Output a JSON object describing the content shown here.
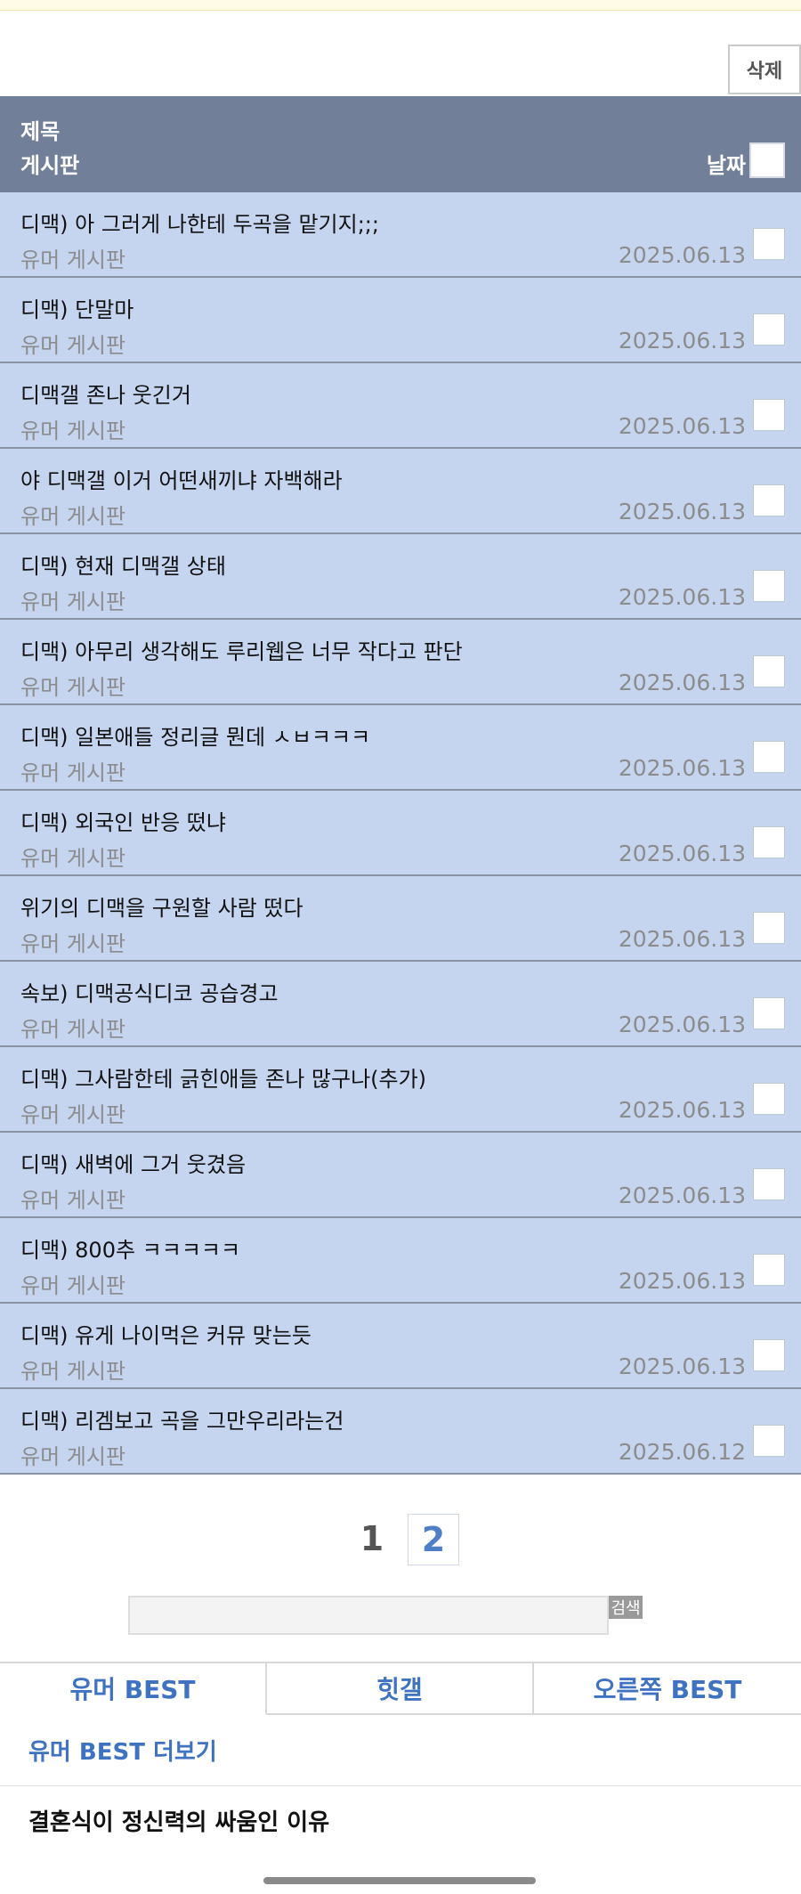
{
  "toolbar": {
    "delete_label": "삭제"
  },
  "table": {
    "header": {
      "title": "제목",
      "board": "게시판",
      "date": "날짜"
    },
    "rows": [
      {
        "title": "디맥) 아 그러게 나한테 두곡을 맡기지;;;",
        "board": "유머 게시판",
        "date": "2025.06.13"
      },
      {
        "title": "디맥) 단말마",
        "board": "유머 게시판",
        "date": "2025.06.13"
      },
      {
        "title": "디맥갤 존나 웃긴거",
        "board": "유머 게시판",
        "date": "2025.06.13"
      },
      {
        "title": "야 디맥갤 이거 어떤새끼냐 자백해라",
        "board": "유머 게시판",
        "date": "2025.06.13"
      },
      {
        "title": "디맥) 현재 디맥갤 상태",
        "board": "유머 게시판",
        "date": "2025.06.13"
      },
      {
        "title": "디맥) 아무리 생각해도 루리웹은 너무 작다고 판단",
        "board": "유머 게시판",
        "date": "2025.06.13"
      },
      {
        "title": "디맥) 일본애들 정리글 뭔데 ㅅㅂㅋㅋㅋ",
        "board": "유머 게시판",
        "date": "2025.06.13"
      },
      {
        "title": "디맥) 외국인 반응 떴냐",
        "board": "유머 게시판",
        "date": "2025.06.13"
      },
      {
        "title": "위기의 디맥을 구원할 사람 떴다",
        "board": "유머 게시판",
        "date": "2025.06.13"
      },
      {
        "title": "속보) 디맥공식디코 공습경고",
        "board": "유머 게시판",
        "date": "2025.06.13"
      },
      {
        "title": "디맥) 그사람한테 긁힌애들 존나 많구나(추가)",
        "board": "유머 게시판",
        "date": "2025.06.13"
      },
      {
        "title": "디맥) 새벽에 그거 웃겼음",
        "board": "유머 게시판",
        "date": "2025.06.13"
      },
      {
        "title": "디맥) 800추 ㅋㅋㅋㅋㅋ",
        "board": "유머 게시판",
        "date": "2025.06.13"
      },
      {
        "title": "디맥) 유게 나이먹은 커뮤 맞는듯",
        "board": "유머 게시판",
        "date": "2025.06.13"
      },
      {
        "title": "디맥) 리겜보고 곡을 그만우리라는건",
        "board": "유머 게시판",
        "date": "2025.06.12"
      }
    ]
  },
  "pagination": {
    "current": "1",
    "next": "2"
  },
  "search": {
    "placeholder": "",
    "button_label": "검색"
  },
  "best_tabs": [
    "유머 BEST",
    "힛갤",
    "오른쪽 BEST"
  ],
  "best": {
    "more_label": "유머 BEST 더보기",
    "items": [
      "결혼식이 정신력의 싸움인 이유"
    ]
  }
}
